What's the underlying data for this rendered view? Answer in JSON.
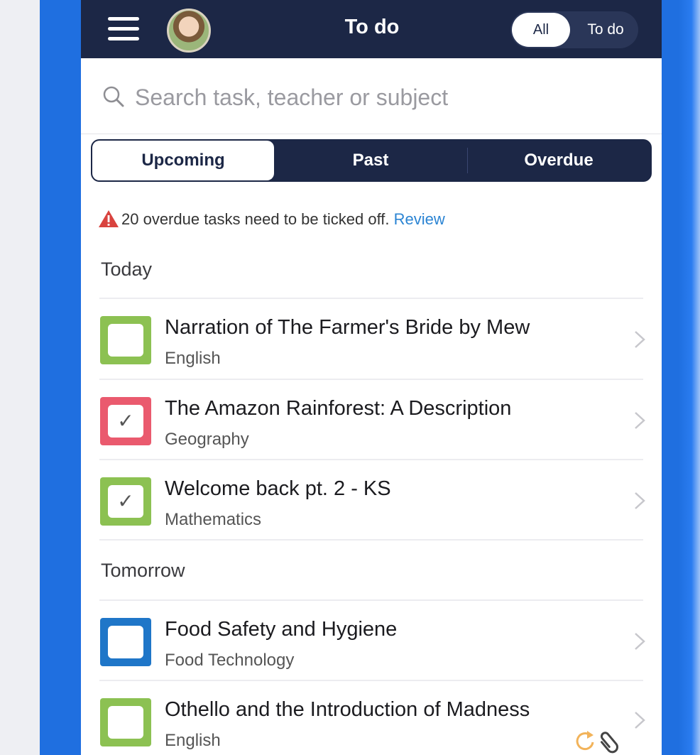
{
  "header": {
    "title": "To do",
    "filter_all": "All",
    "filter_todo": "To do"
  },
  "search": {
    "placeholder": "Search task, teacher or subject"
  },
  "segments": {
    "upcoming": "Upcoming",
    "past": "Past",
    "overdue": "Overdue"
  },
  "alert": {
    "text": "20 overdue tasks need to be ticked off.",
    "link": "Review"
  },
  "sections": {
    "today": "Today",
    "tomorrow": "Tomorrow"
  },
  "tasks": [
    {
      "title": "Narration of The Farmer's Bride by Mew",
      "subject": "English",
      "color": "#8cc152",
      "checked": false
    },
    {
      "title": "The Amazon Rainforest: A Description",
      "subject": "Geography",
      "color": "#ea5a6e",
      "checked": true
    },
    {
      "title": "Welcome back pt. 2 - KS",
      "subject": "Mathematics",
      "color": "#8cc152",
      "checked": true
    },
    {
      "title": "Food Safety and Hygiene",
      "subject": "Food Technology",
      "color": "#1f76c8",
      "checked": false
    },
    {
      "title": "Othello and the Introduction of Madness",
      "subject": "English",
      "color": "#8cc152",
      "checked": false
    }
  ],
  "colors": {
    "header_bg": "#1c2746",
    "link": "#2b84d3",
    "alert_red": "#d9433f"
  },
  "icons": {
    "menu": "hamburger-icon",
    "search": "search-icon",
    "alert": "warning-icon",
    "row_chevron": "chevron-right-icon",
    "refresh": "refresh-icon",
    "attachment": "paperclip-icon"
  }
}
